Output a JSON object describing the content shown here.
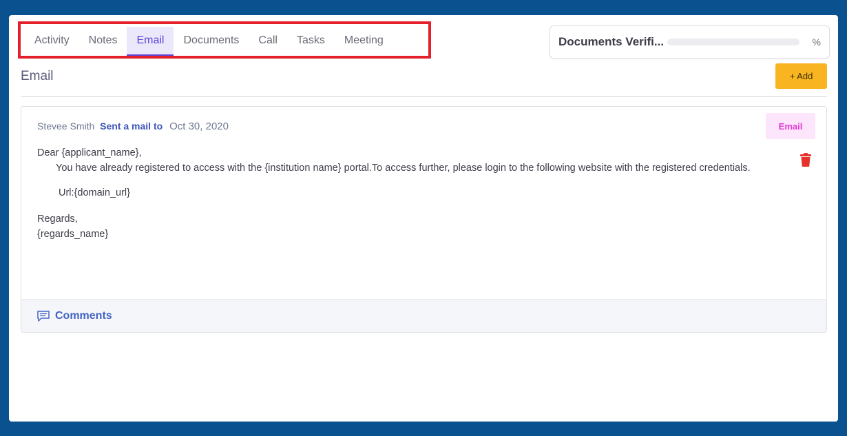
{
  "tabs": [
    {
      "label": "Activity",
      "active": false
    },
    {
      "label": "Notes",
      "active": false
    },
    {
      "label": "Email",
      "active": true
    },
    {
      "label": "Documents",
      "active": false
    },
    {
      "label": "Call",
      "active": false
    },
    {
      "label": "Tasks",
      "active": false
    },
    {
      "label": "Meeting",
      "active": false
    }
  ],
  "verification": {
    "title": "Documents Verifi...",
    "percent_symbol": "%",
    "progress": 0
  },
  "section": {
    "title": "Email",
    "add_label": "+ Add"
  },
  "email_card": {
    "author": "Stevee Smith",
    "action": "Sent a mail to",
    "date": "Oct 30, 2020",
    "badge": "Email",
    "greeting": "Dear {applicant_name},",
    "line1": "You have already registered to access with the {institution name} portal.To access further, please login to the following website with the registered credentials.",
    "url_line": "Url:{domain_url}",
    "regards": "Regards,",
    "regards_name": "{regards_name}",
    "comments_label": "Comments"
  },
  "colors": {
    "accent": "#5b45d9",
    "add_button": "#f9b521",
    "badge_bg": "#fde6fb",
    "badge_text": "#e03cd6",
    "trash": "#e5322d",
    "highlight_border": "#e3202a"
  },
  "icons": {
    "trash": "trash-icon",
    "comments": "comment-icon"
  }
}
